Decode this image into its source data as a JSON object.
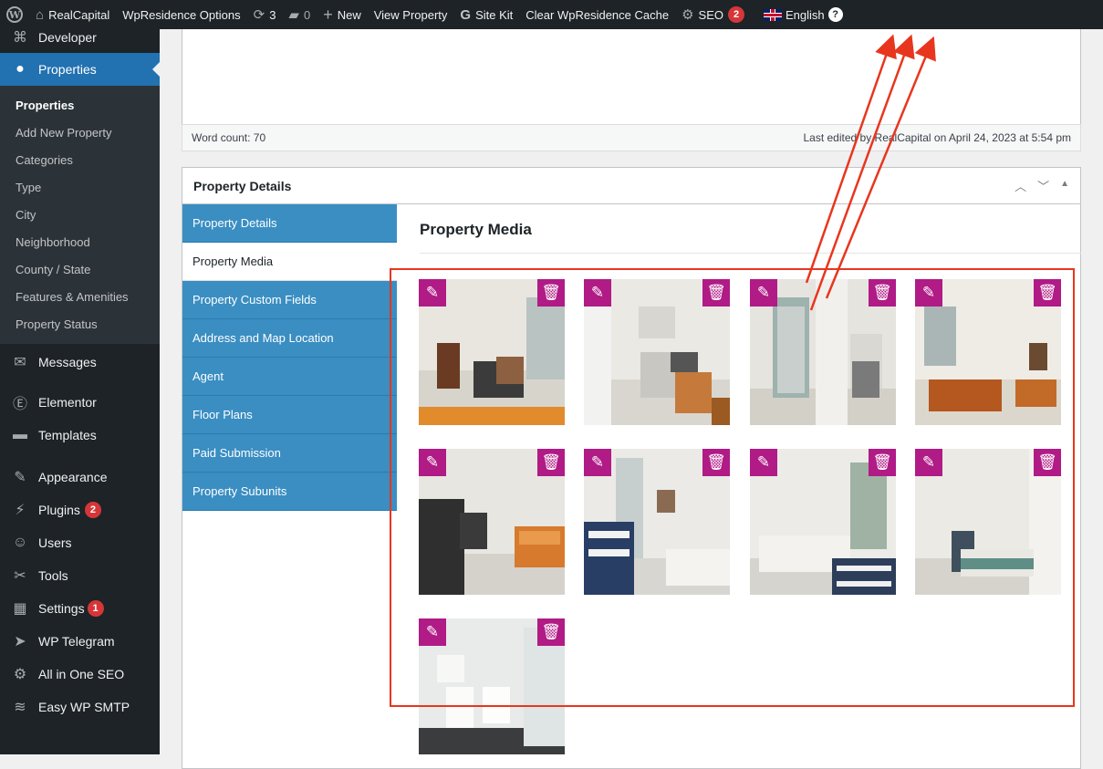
{
  "adminbar": {
    "site_name": "RealCapital",
    "wpresidence_options": "WpResidence Options",
    "updates_count": "3",
    "comments_count": "0",
    "new_label": "New",
    "view_property": "View Property",
    "site_kit": "Site Kit",
    "clear_cache": "Clear WpResidence Cache",
    "seo_label": "SEO",
    "seo_count": "2",
    "language": "English"
  },
  "sidebar": {
    "developer": "Developer",
    "properties": "Properties",
    "submenu": [
      "Properties",
      "Add New Property",
      "Categories",
      "Type",
      "City",
      "Neighborhood",
      "County / State",
      "Features & Amenities",
      "Property Status"
    ],
    "messages": "Messages",
    "elementor": "Elementor",
    "templates": "Templates",
    "appearance": "Appearance",
    "plugins": "Plugins",
    "plugins_count": "2",
    "users": "Users",
    "tools": "Tools",
    "settings": "Settings",
    "settings_count": "1",
    "wp_telegram": "WP Telegram",
    "aioseo": "All in One SEO",
    "easy_wp_smtp": "Easy WP SMTP"
  },
  "editor": {
    "word_count": "Word count: 70",
    "last_edited": "Last edited by RealCapital on April 24, 2023 at 5:54 pm"
  },
  "postbox": {
    "title": "Property Details",
    "tabs": [
      "Property Details",
      "Property Media",
      "Property Custom Fields",
      "Address and Map Location",
      "Agent",
      "Floor Plans",
      "Paid Submission",
      "Property Subunits"
    ],
    "selected_tab": "Property Media",
    "media_title": "Property Media"
  },
  "colors": {
    "adminbar_bg": "#1d2327",
    "active_menu": "#2271b1",
    "tab_blue": "#3a8ec2",
    "thumb_control": "#b01b86",
    "annotation_red": "#e8361e"
  }
}
